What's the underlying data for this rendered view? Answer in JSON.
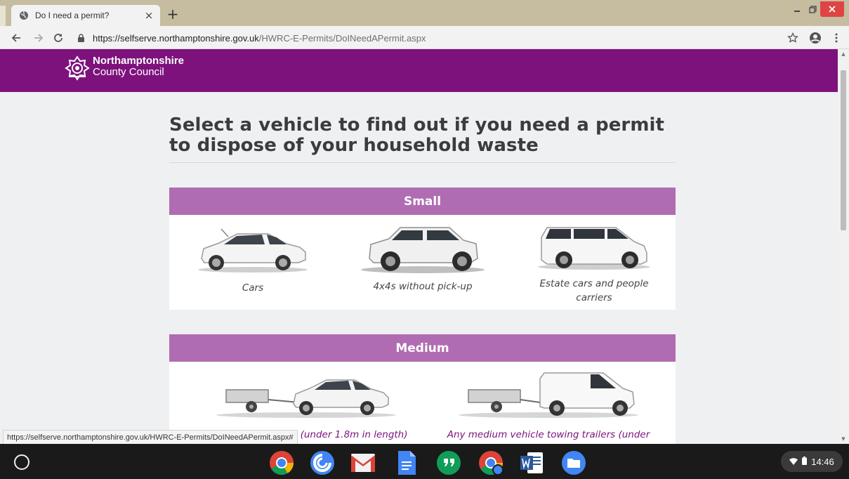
{
  "browser": {
    "tab_title": "Do I need a permit?",
    "tab_close": "×",
    "new_tab": "+",
    "url_host": "https://selfserve.northamptonshire.gov.uk",
    "url_path": "/HWRC-E-Permits/DoINeedAPermit.aspx",
    "status_url": "https://selfserve.northamptonshire.gov.uk/HWRC-E-Permits/DoINeedAPermit.aspx#"
  },
  "site": {
    "logo_line1": "Northamptonshire",
    "logo_line2": "County Council"
  },
  "main": {
    "heading": "Select a vehicle to find out if you need a permit to dispose of your household waste",
    "categories": [
      {
        "title": "Small",
        "vehicles": [
          {
            "label": "Cars",
            "icon": "hatchback-car-image"
          },
          {
            "label": "4x4s without pick-up",
            "icon": "suv-image"
          },
          {
            "label": "Estate cars and people carriers",
            "icon": "people-carrier-image"
          }
        ]
      },
      {
        "title": "Medium",
        "vehicles": [
          {
            "label": "Cars towing trailers (under 1.8m in length)",
            "icon": "car-with-trailer-image"
          },
          {
            "label": "Any medium vehicle towing trailers (under",
            "icon": "van-with-trailer-image"
          }
        ]
      }
    ]
  },
  "shelf": {
    "apps": [
      "chrome-icon",
      "chrome-remote-icon",
      "gmail-icon",
      "google-docs-icon",
      "hangouts-icon",
      "chrome-canary-icon",
      "word-icon",
      "files-icon"
    ],
    "time": "14:46"
  },
  "colors": {
    "header_purple": "#7d127d",
    "category_purple": "#b06cb2",
    "page_bg": "#eef0f2"
  }
}
